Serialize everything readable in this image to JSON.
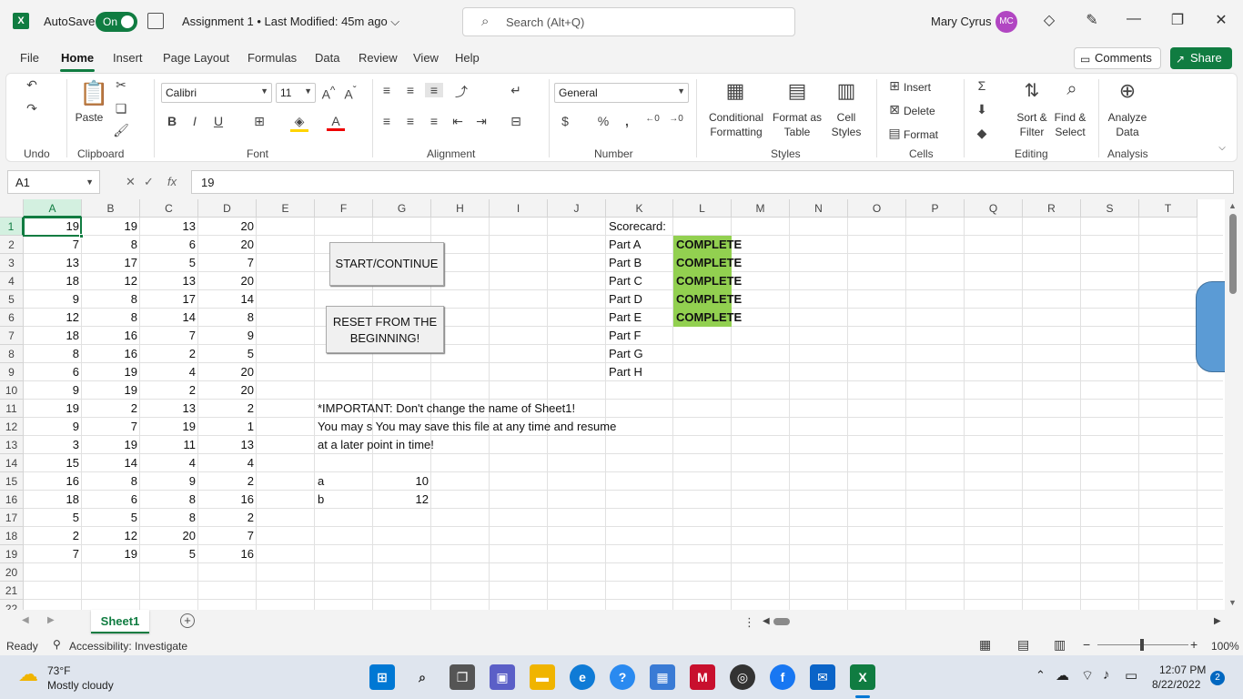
{
  "titlebar": {
    "autosave_label": "AutoSave",
    "autosave_state": "On",
    "doc_title": "Assignment 1 • Last Modified: 45m ago ⌵",
    "search_placeholder": "Search (Alt+Q)",
    "user_name": "Mary Cyrus",
    "user_initials": "MC"
  },
  "menu": {
    "tabs": [
      "File",
      "Home",
      "Insert",
      "Page Layout",
      "Formulas",
      "Data",
      "Review",
      "View",
      "Help"
    ],
    "active_tab": "Home",
    "comments_label": "Comments",
    "share_label": "Share"
  },
  "ribbon": {
    "groups": [
      "Undo",
      "Clipboard",
      "Font",
      "Alignment",
      "Number",
      "Styles",
      "Cells",
      "Editing",
      "Analysis"
    ],
    "paste_label": "Paste",
    "font_name": "Calibri",
    "font_size": "11",
    "number_format": "General",
    "conditional_formatting": "Conditional Formatting",
    "format_as_table": "Format as Table",
    "cell_styles": "Cell Styles",
    "insert": "Insert",
    "delete": "Delete",
    "format": "Format",
    "sort_filter": "Sort & Filter",
    "find_select": "Find & Select",
    "analyze_data": "Analyze Data"
  },
  "formula_bar": {
    "name_box": "A1",
    "fx": "fx",
    "value": "19"
  },
  "grid": {
    "columns": [
      "A",
      "B",
      "C",
      "D",
      "E",
      "F",
      "G",
      "H",
      "I",
      "J",
      "K",
      "L",
      "M",
      "N",
      "O",
      "P",
      "Q",
      "R",
      "S",
      "T"
    ],
    "rows": [
      "1",
      "2",
      "3",
      "4",
      "5",
      "6",
      "7",
      "8",
      "9",
      "10",
      "11",
      "12",
      "13",
      "14",
      "15",
      "16",
      "17",
      "18",
      "19",
      "20",
      "21",
      "22"
    ],
    "data_A": [
      "19",
      "7",
      "13",
      "18",
      "9",
      "12",
      "18",
      "8",
      "6",
      "9",
      "19",
      "9",
      "3",
      "15",
      "16",
      "18",
      "5",
      "2",
      "7"
    ],
    "data_B": [
      "19",
      "8",
      "17",
      "12",
      "8",
      "8",
      "16",
      "16",
      "19",
      "19",
      "2",
      "7",
      "19",
      "14",
      "8",
      "6",
      "5",
      "12",
      "19"
    ],
    "data_C": [
      "13",
      "6",
      "5",
      "13",
      "17",
      "14",
      "7",
      "2",
      "4",
      "2",
      "13",
      "19",
      "11",
      "4",
      "9",
      "8",
      "8",
      "20",
      "5"
    ],
    "data_D": [
      "20",
      "20",
      "7",
      "20",
      "14",
      "8",
      "9",
      "5",
      "20",
      "20",
      "2",
      "1",
      "13",
      "4",
      "2",
      "16",
      "2",
      "7",
      "16"
    ],
    "scorecard_title": "Scorecard:",
    "parts": [
      "Part A",
      "Part B",
      "Part C",
      "Part D",
      "Part E",
      "Part F",
      "Part G",
      "Part H"
    ],
    "status_complete": "COMPLETE",
    "complete_count": 5,
    "note_line1": "*IMPORTANT: Don't change the name of Sheet1!",
    "note_line2": "You may s You may save this file at any time and resume",
    "note_line3": "at a later point in time!",
    "var_a_label": "a",
    "var_a_value": "10",
    "var_b_label": "b",
    "var_b_value": "12",
    "start_button": "START/CONTINUE",
    "reset_button_line1": "RESET FROM THE",
    "reset_button_line2": "BEGINNING!"
  },
  "sheets": {
    "active": "Sheet1"
  },
  "status": {
    "ready": "Ready",
    "accessibility": "Accessibility: Investigate",
    "zoom": "100%"
  },
  "taskbar": {
    "weather_temp": "73°F",
    "weather_desc": "Mostly cloudy",
    "time": "12:07 PM",
    "date": "8/22/2022",
    "notifications": "2"
  }
}
